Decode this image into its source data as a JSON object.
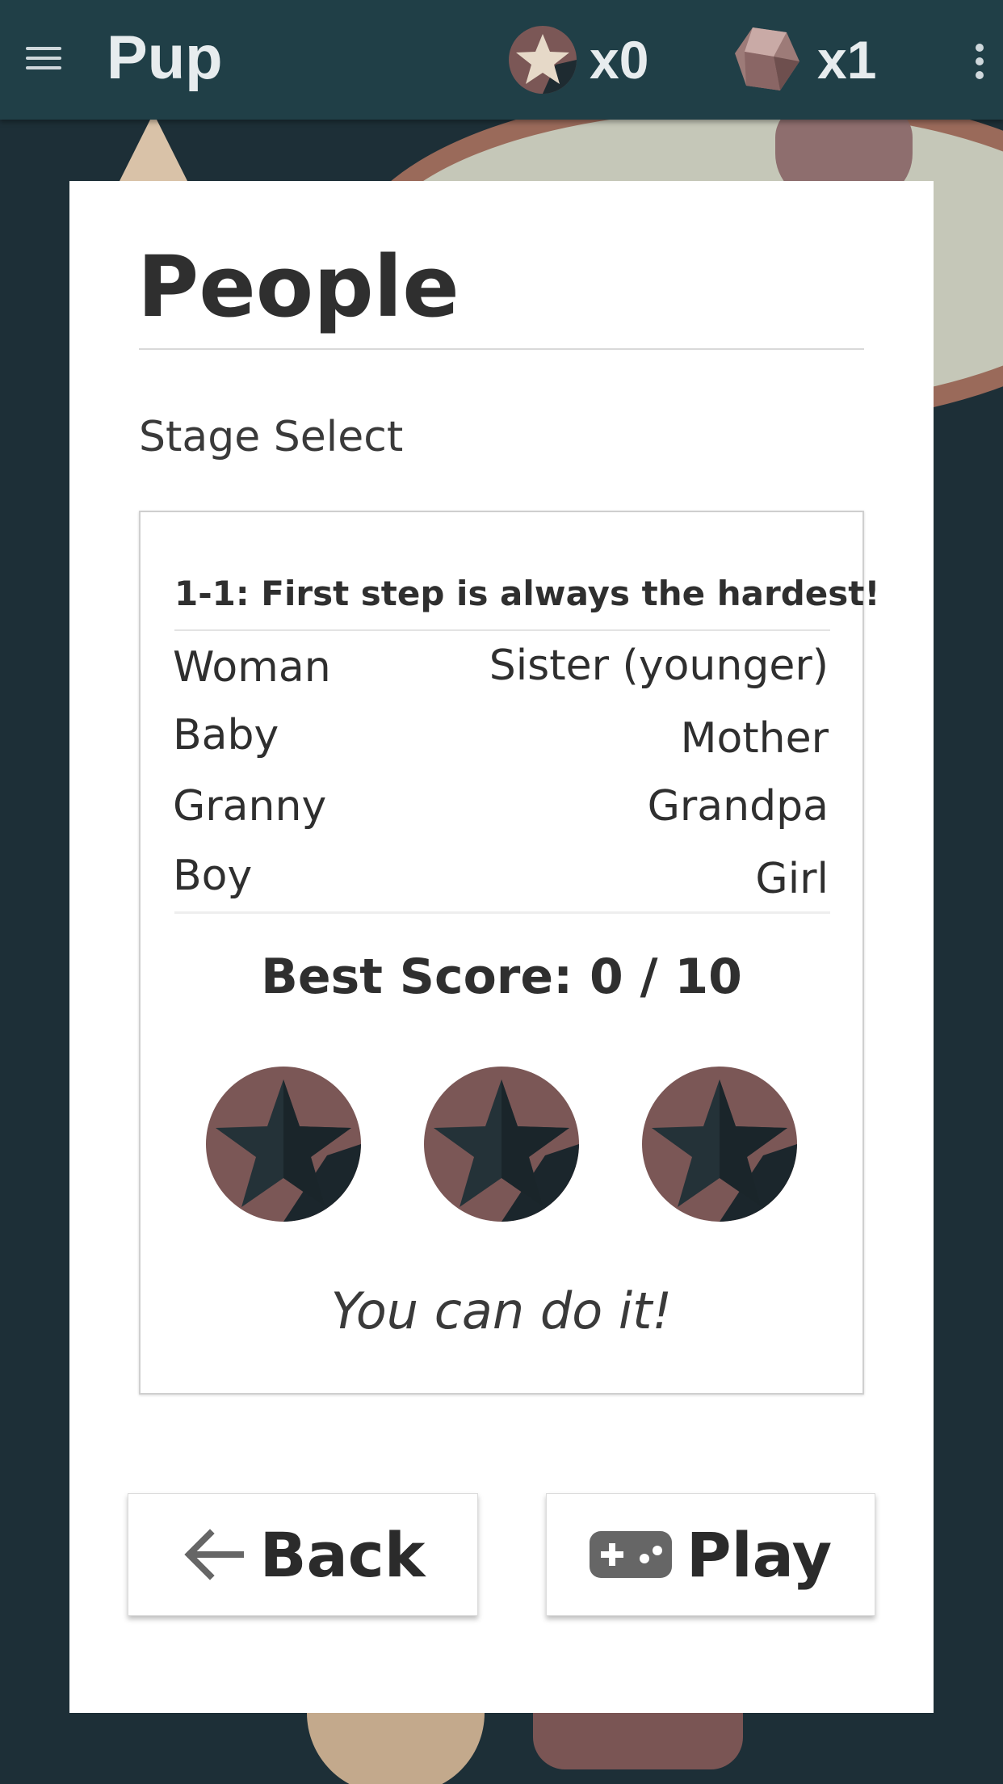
{
  "app_bar": {
    "title": "Pup",
    "stars_count": "x0",
    "gems_count": "x1"
  },
  "card": {
    "title": "People",
    "subtitle": "Stage Select",
    "stage": {
      "name": "1-1: First step is always the hardest!",
      "words_left": [
        "Woman",
        "Baby",
        "Granny",
        "Boy"
      ],
      "words_right": [
        "Sister (younger)",
        "Mother",
        "Grandpa",
        "Girl"
      ],
      "best_score": "Best Score: 0 / 10",
      "medals_earned": 0,
      "medals_total": 3,
      "encouragement": "You can do it!"
    }
  },
  "buttons": {
    "back": "Back",
    "play": "Play"
  },
  "colors": {
    "app_bar": "#203f47",
    "background": "#1d2f37",
    "medal": "#7b5756",
    "medal_star": "#243238"
  },
  "icons": [
    "menu-icon",
    "star-icon",
    "gem-icon",
    "more-vert-icon",
    "arrow-left-icon",
    "gamepad-icon"
  ]
}
